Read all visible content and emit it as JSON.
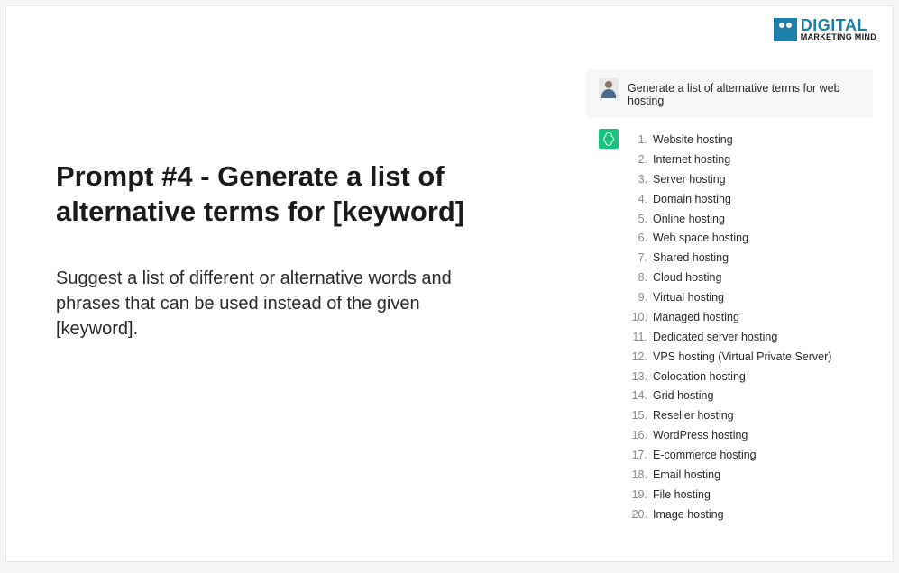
{
  "logo": {
    "top": "DIGITAL",
    "bottom": "MARKETING MIND"
  },
  "left": {
    "heading": "Prompt #4 - Generate a list of alternative terms for [keyword]",
    "description": "Suggest a list of different or alternative words and phrases that can be used instead of the given [keyword]."
  },
  "chat": {
    "userPrompt": "Generate a list of alternative terms for web hosting",
    "items": [
      "Website hosting",
      "Internet hosting",
      "Server hosting",
      "Domain hosting",
      "Online hosting",
      "Web space hosting",
      "Shared hosting",
      "Cloud hosting",
      "Virtual hosting",
      "Managed hosting",
      "Dedicated server hosting",
      "VPS hosting (Virtual Private Server)",
      "Colocation hosting",
      "Grid hosting",
      "Reseller hosting",
      "WordPress hosting",
      "E-commerce hosting",
      "Email hosting",
      "File hosting",
      "Image hosting"
    ]
  }
}
